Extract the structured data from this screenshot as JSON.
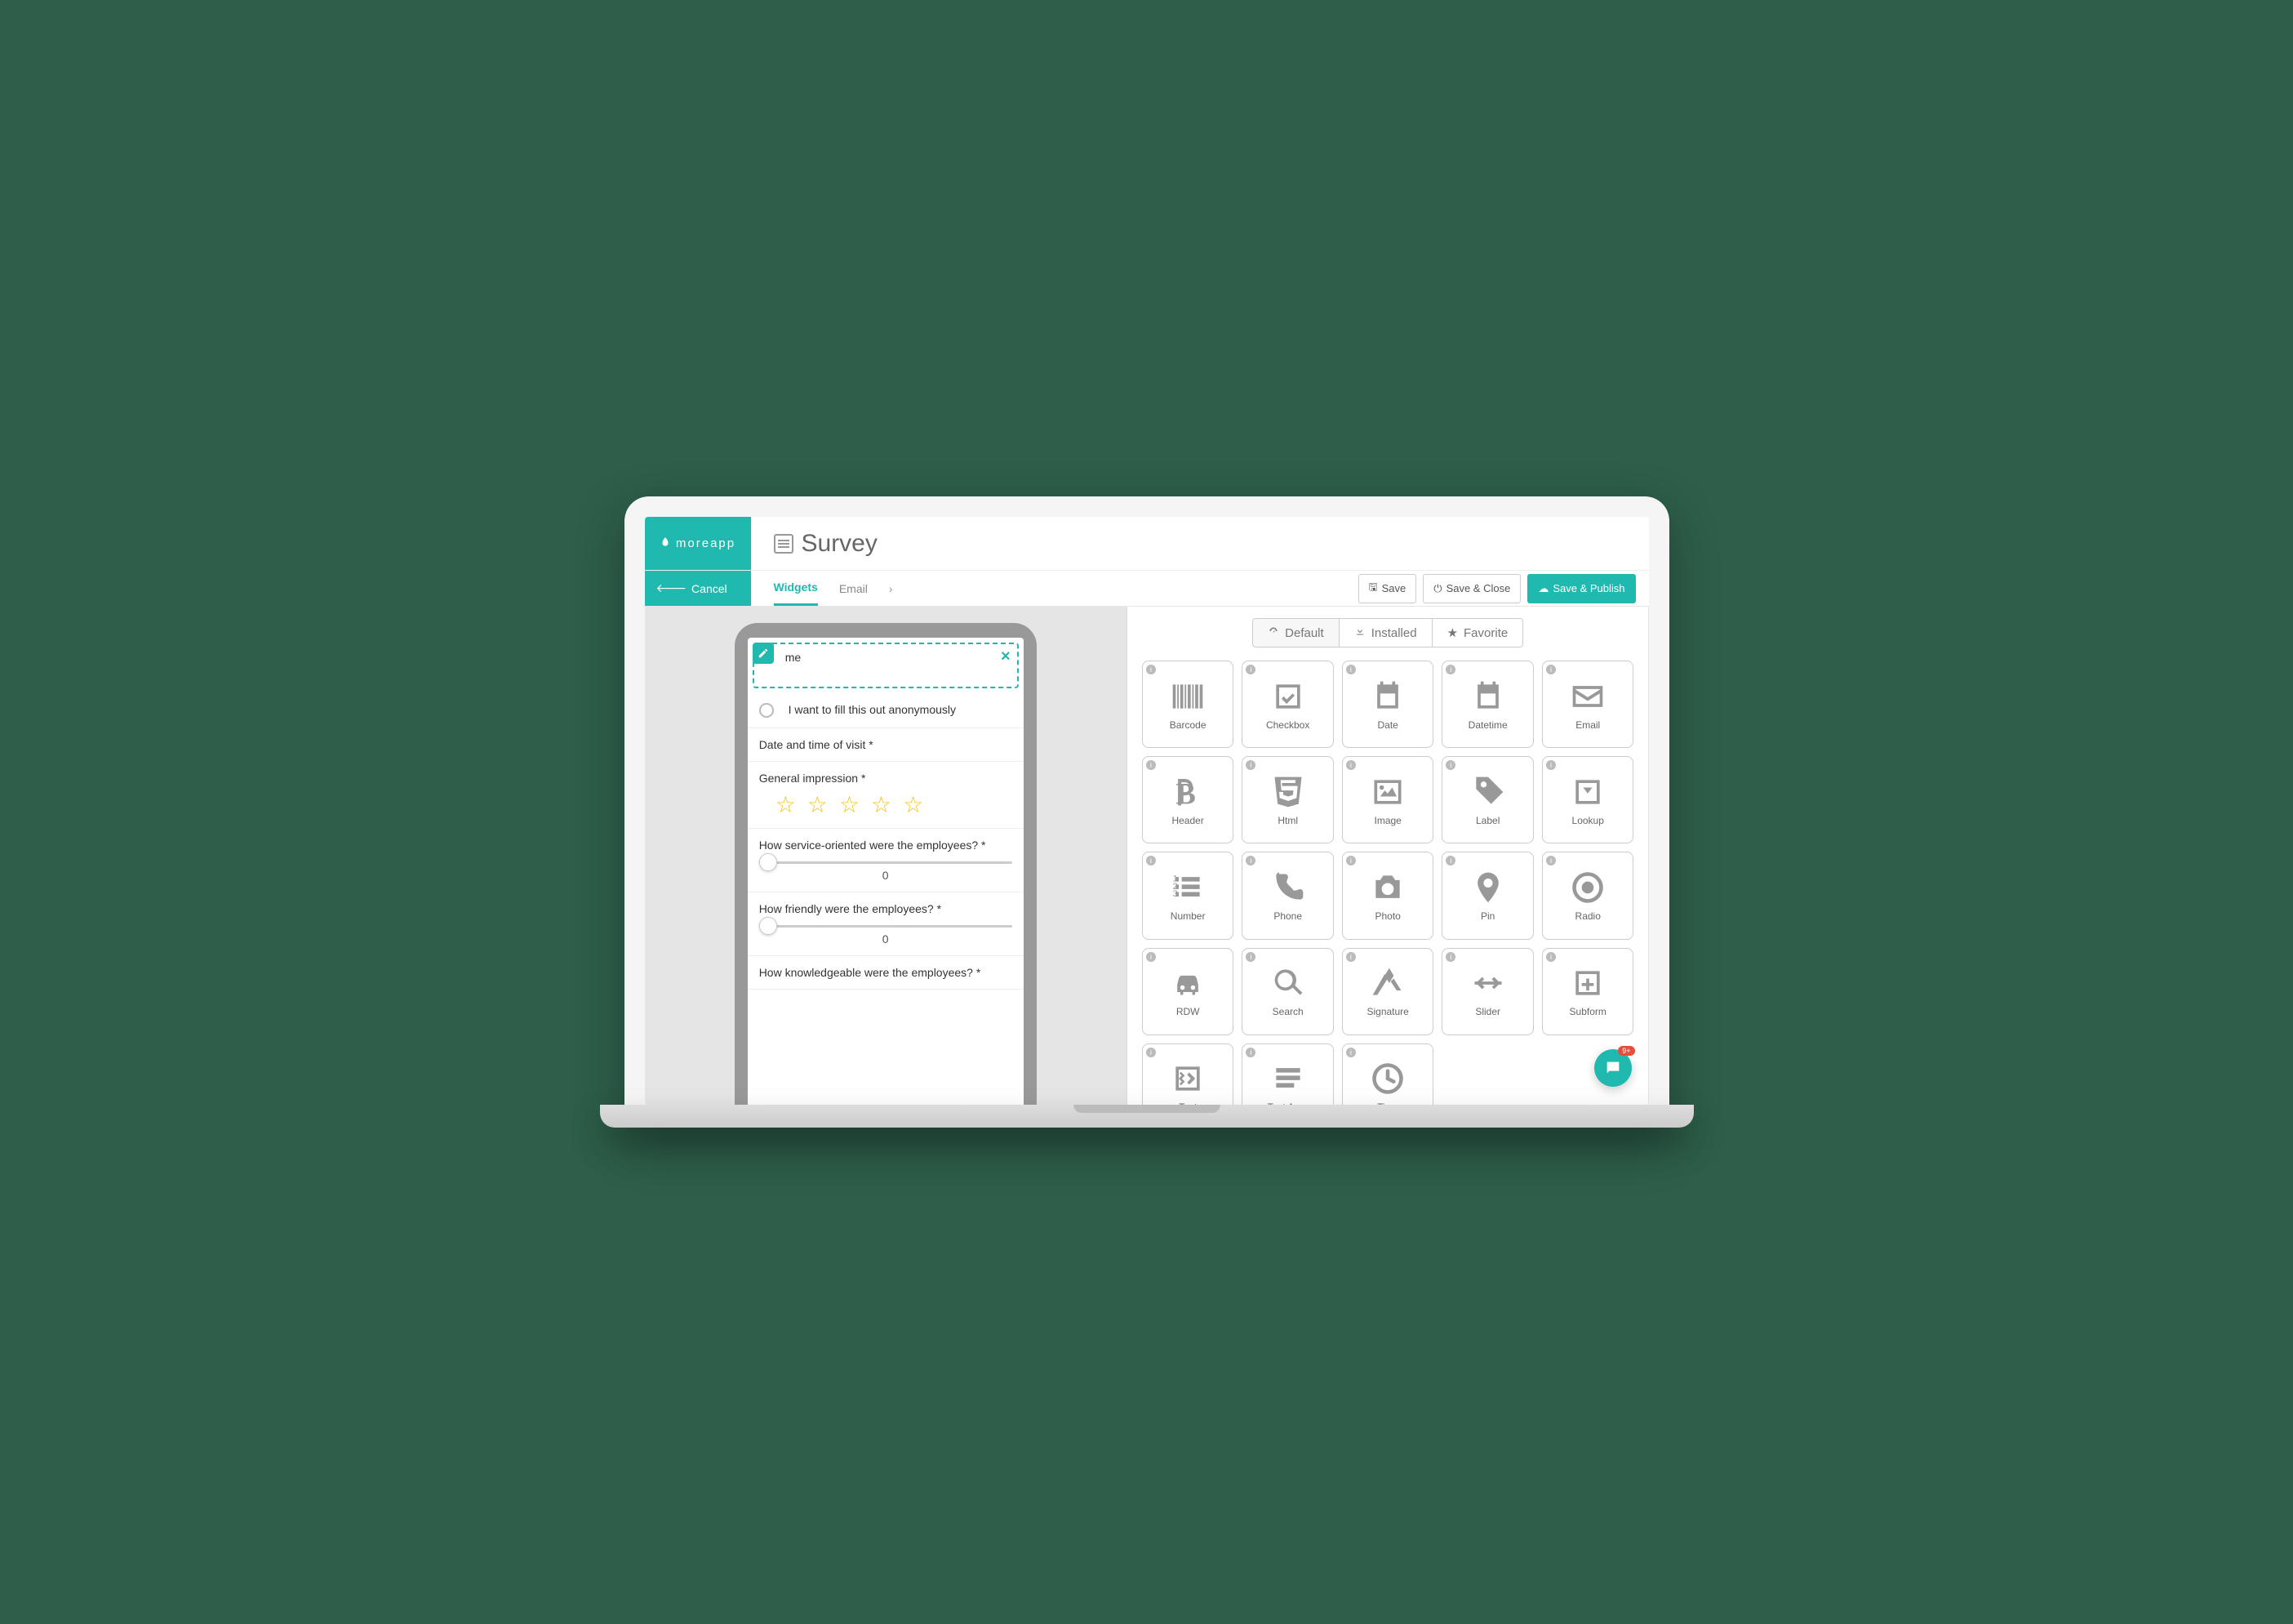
{
  "brand": "moreapp",
  "page_title": "Survey",
  "cancel_label": "Cancel",
  "tabs": {
    "widgets": "Widgets",
    "email": "Email"
  },
  "buttons": {
    "save": "Save",
    "save_close": "Save & Close",
    "save_publish": "Save & Publish"
  },
  "preview": {
    "selected_field_label": "me",
    "anonymous": "I want to fill this out anonymously",
    "datetime": "Date and time of visit *",
    "impression": "General impression *",
    "q_service": "How service-oriented were the employees? *",
    "q_friendly": "How friendly were the employees? *",
    "q_knowledge": "How knowledgeable were the employees? *",
    "slider_value": "0"
  },
  "widget_tabs": {
    "default": "Default",
    "installed": "Installed",
    "favorite": "Favorite"
  },
  "widgets": [
    {
      "label": "Barcode"
    },
    {
      "label": "Checkbox"
    },
    {
      "label": "Date"
    },
    {
      "label": "Datetime"
    },
    {
      "label": "Email"
    },
    {
      "label": "Header"
    },
    {
      "label": "Html"
    },
    {
      "label": "Image"
    },
    {
      "label": "Label"
    },
    {
      "label": "Lookup"
    },
    {
      "label": "Number"
    },
    {
      "label": "Phone"
    },
    {
      "label": "Photo"
    },
    {
      "label": "Pin"
    },
    {
      "label": "Radio"
    },
    {
      "label": "RDW"
    },
    {
      "label": "Search"
    },
    {
      "label": "Signature"
    },
    {
      "label": "Slider"
    },
    {
      "label": "Subform"
    },
    {
      "label": "Text"
    },
    {
      "label": "Text Area"
    },
    {
      "label": "Time"
    }
  ],
  "chat_badge": "9+"
}
